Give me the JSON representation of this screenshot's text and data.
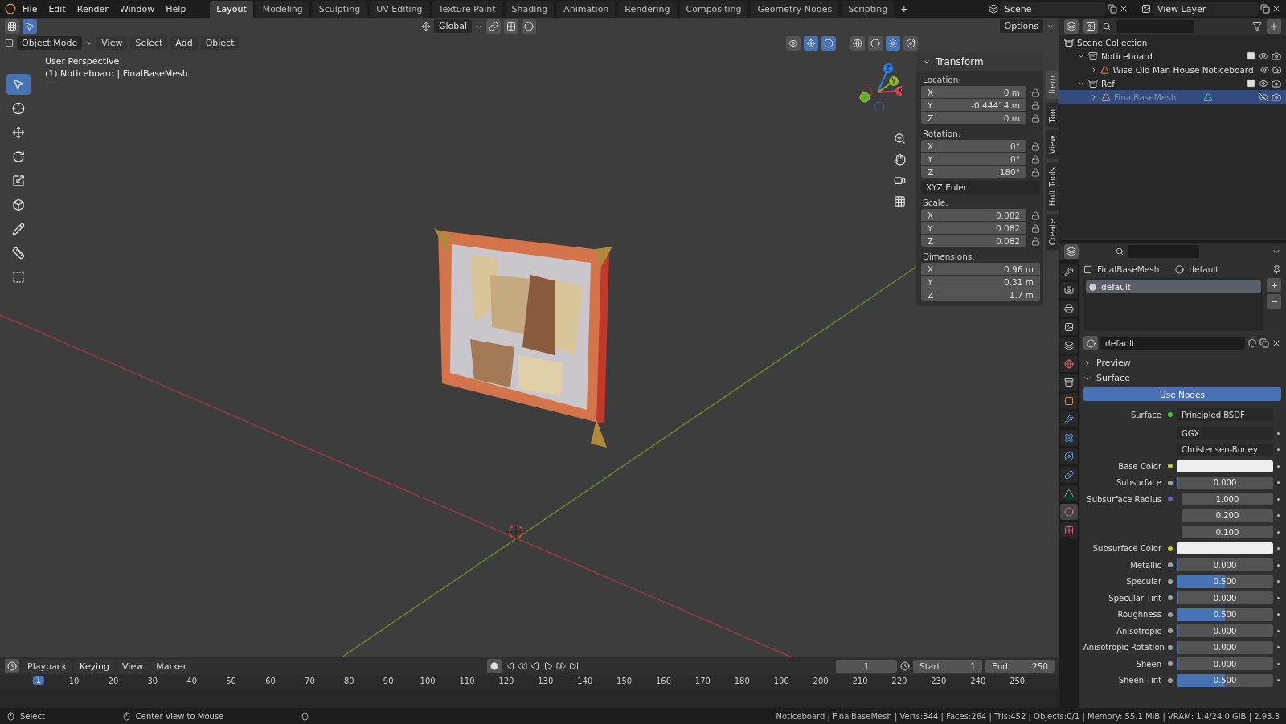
{
  "menubar": {
    "menus": [
      "File",
      "Edit",
      "Render",
      "Window",
      "Help"
    ],
    "workspaces": [
      {
        "label": "Layout",
        "selected": true
      },
      {
        "label": "Modeling",
        "selected": false
      },
      {
        "label": "Sculpting",
        "selected": false
      },
      {
        "label": "UV Editing",
        "selected": false
      },
      {
        "label": "Texture Paint",
        "selected": false
      },
      {
        "label": "Shading",
        "selected": false
      },
      {
        "label": "Animation",
        "selected": false
      },
      {
        "label": "Rendering",
        "selected": false
      },
      {
        "label": "Compositing",
        "selected": false
      },
      {
        "label": "Geometry Nodes",
        "selected": false
      },
      {
        "label": "Scripting",
        "selected": false
      }
    ],
    "add_tab": "+",
    "scene": "Scene",
    "view_layer": "View Layer"
  },
  "viewport": {
    "transform_orientation": "Global",
    "options": "Options",
    "mode": "Object Mode",
    "menus": [
      "View",
      "Select",
      "Add",
      "Object"
    ],
    "shading_modes": [
      {
        "kind": "wireframe",
        "selected": false
      },
      {
        "kind": "solid",
        "selected": false
      },
      {
        "kind": "material",
        "selected": true
      },
      {
        "kind": "rendered",
        "selected": false
      }
    ],
    "overlay_text": [
      "User Perspective",
      "(1) Noticeboard | FinalBaseMesh"
    ],
    "tools": [
      {
        "kind": "select",
        "selected": true
      },
      {
        "kind": "cursor",
        "selected": false
      },
      {
        "kind": "move",
        "selected": false
      },
      {
        "kind": "rotate",
        "selected": false
      },
      {
        "kind": "scale",
        "selected": false
      },
      {
        "kind": "transform",
        "selected": false
      },
      {
        "kind": "annotate",
        "selected": false
      },
      {
        "kind": "measure",
        "selected": false
      },
      {
        "kind": "add_cube",
        "selected": false
      }
    ],
    "gizmo_axes": [
      "Z",
      "Y",
      "X"
    ],
    "n_panel": {
      "title": "Transform",
      "groups": [
        {
          "label": "Location:",
          "fields": [
            {
              "axis": "X",
              "value": "0 m"
            },
            {
              "axis": "Y",
              "value": "-0.44414 m"
            },
            {
              "axis": "Z",
              "value": "0 m"
            }
          ],
          "locks": true
        },
        {
          "label": "Rotation:",
          "fields": [
            {
              "axis": "X",
              "value": "0°"
            },
            {
              "axis": "Y",
              "value": "0°"
            },
            {
              "axis": "Z",
              "value": "180°"
            }
          ],
          "locks": true,
          "mode": "XYZ Euler"
        },
        {
          "label": "Scale:",
          "fields": [
            {
              "axis": "X",
              "value": "0.082"
            },
            {
              "axis": "Y",
              "value": "0.082"
            },
            {
              "axis": "Z",
              "value": "0.082"
            }
          ],
          "locks": true
        },
        {
          "label": "Dimensions:",
          "fields": [
            {
              "axis": "X",
              "value": "0.96 m"
            },
            {
              "axis": "Y",
              "value": "0.31 m"
            },
            {
              "axis": "Z",
              "value": "1.7 m"
            }
          ],
          "locks": false
        }
      ]
    },
    "side_tabs": [
      {
        "label": "Item",
        "selected": true
      },
      {
        "label": "Tool",
        "selected": false
      },
      {
        "label": "View",
        "selected": false
      },
      {
        "label": "Holt Tools",
        "selected": false
      },
      {
        "label": "Create",
        "selected": false
      }
    ]
  },
  "timeline": {
    "menus": [
      "Playback",
      "Keying",
      "View",
      "Marker"
    ],
    "current_frame": "1",
    "start_label": "Start",
    "start": "1",
    "end_label": "End",
    "end": "250",
    "playhead": "1",
    "ticks": [
      "10",
      "20",
      "30",
      "40",
      "50",
      "60",
      "70",
      "80",
      "90",
      "100",
      "110",
      "120",
      "130",
      "140",
      "150",
      "160",
      "170",
      "180",
      "190",
      "200",
      "210",
      "220",
      "230",
      "240",
      "250"
    ]
  },
  "outliner": {
    "tree": [
      {
        "label": "Scene Collection",
        "kind": "scene",
        "children": [
          {
            "label": "Noticeboard",
            "kind": "collection",
            "expanded": true,
            "checked": true,
            "visible": true,
            "selected": false,
            "children": [
              {
                "label": "Wise Old Man House Noticeboard",
                "kind": "object",
                "expanded": false,
                "visible": true,
                "selected": false
              }
            ]
          },
          {
            "label": "Ref",
            "kind": "collection",
            "expanded": true,
            "checked": true,
            "visible": true,
            "selected": false,
            "children": [
              {
                "label": "FinalBaseMesh",
                "kind": "mesh",
                "expanded": false,
                "visible": false,
                "selected": true
              }
            ]
          }
        ]
      }
    ]
  },
  "properties": {
    "tabs": [
      {
        "kind": "tool",
        "selected": false
      },
      {
        "kind": "render",
        "selected": false
      },
      {
        "kind": "output",
        "selected": false
      },
      {
        "kind": "view_layer",
        "selected": false
      },
      {
        "kind": "scene",
        "selected": false
      },
      {
        "kind": "world",
        "selected": false
      },
      {
        "kind": "collection",
        "selected": false
      },
      {
        "kind": "object",
        "selected": false
      },
      {
        "kind": "modifiers",
        "selected": false
      },
      {
        "kind": "particles",
        "selected": false
      },
      {
        "kind": "physics",
        "selected": false
      },
      {
        "kind": "constraints",
        "selected": false
      },
      {
        "kind": "data",
        "selected": false
      },
      {
        "kind": "material",
        "selected": true
      },
      {
        "kind": "texture",
        "selected": false
      }
    ],
    "breadcrumb": [
      "FinalBaseMesh",
      "default"
    ],
    "slots": [
      {
        "name": "default",
        "selected": true
      }
    ],
    "material": "default",
    "sections": [
      {
        "label": "Preview",
        "expanded": false
      },
      {
        "label": "Surface",
        "expanded": true
      }
    ],
    "use_nodes": "Use Nodes",
    "surface_label": "Surface",
    "surface_value": "Principled BSDF",
    "dropdowns": [
      "GGX",
      "Christensen-Burley"
    ],
    "inputs": [
      {
        "label": "Base Color",
        "kind": "color",
        "color": "#c7c729"
      },
      {
        "label": "Subsurface",
        "kind": "slider",
        "color": "#a1a1a1",
        "value": "0.000",
        "level": 0
      },
      {
        "label": "Subsurface Radius",
        "kind": "vector",
        "color": "#6363c7",
        "values": [
          "1.000",
          "0.200",
          "0.100"
        ]
      },
      {
        "label": "Subsurface Color",
        "kind": "color",
        "color": "#c7c729"
      },
      {
        "label": "Metallic",
        "kind": "slider",
        "color": "#a1a1a1",
        "value": "0.000",
        "level": 0
      },
      {
        "label": "Specular",
        "kind": "slider",
        "color": "#a1a1a1",
        "value": "0.500",
        "level": 0.5
      },
      {
        "label": "Specular Tint",
        "kind": "slider",
        "color": "#a1a1a1",
        "value": "0.000",
        "level": 0
      },
      {
        "label": "Roughness",
        "kind": "slider",
        "color": "#a1a1a1",
        "value": "0.500",
        "level": 0.5
      },
      {
        "label": "Anisotropic",
        "kind": "slider",
        "color": "#a1a1a1",
        "value": "0.000",
        "level": 0
      },
      {
        "label": "Anisotropic Rotation",
        "kind": "slider",
        "color": "#a1a1a1",
        "value": "0.000",
        "level": 0
      },
      {
        "label": "Sheen",
        "kind": "slider",
        "color": "#a1a1a1",
        "value": "0.000",
        "level": 0
      },
      {
        "label": "Sheen Tint",
        "kind": "slider",
        "color": "#a1a1a1",
        "value": "0.500",
        "level": 0.5
      }
    ]
  },
  "status_bar": {
    "hints": [
      "Select",
      "Center View to Mouse"
    ],
    "stats": "Noticeboard | FinalBaseMesh | Verts:344 | Faces:264 | Tris:452 | Objects:0/1 | Memory: 55.1 MiB | VRAM: 1.4/24.0 GiB | 2.93.3"
  }
}
